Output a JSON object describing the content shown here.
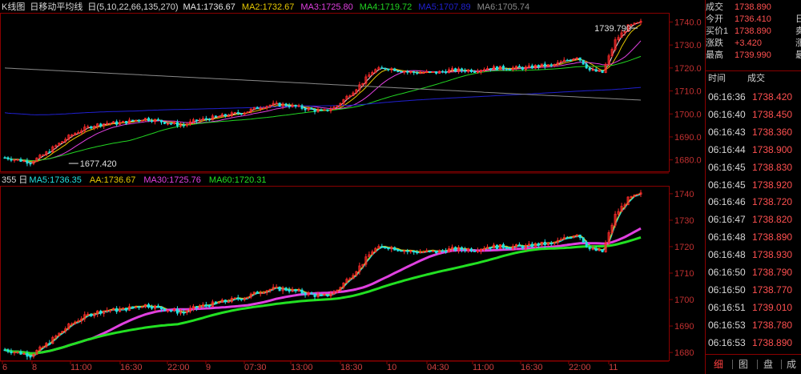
{
  "top_panel": {
    "label_kline": "K线图",
    "label_ma": "日移动平均线",
    "label_params": "日(5,10,22,66,135,270)",
    "ma_values": [
      {
        "label": "MA1:1736.67",
        "color": "#e6e6e6"
      },
      {
        "label": "MA2:1732.67",
        "color": "#e6c800"
      },
      {
        "label": "MA3:1725.80",
        "color": "#e040e0"
      },
      {
        "label": "MA4:1719.72",
        "color": "#22d422"
      },
      {
        "label": "MA5:1707.89",
        "color": "#2020d0"
      },
      {
        "label": "MA6:1705.74",
        "color": "#8a8a8a"
      }
    ],
    "annotation_high": "1739.790",
    "annotation_low": "1677.420"
  },
  "bottom_panel": {
    "label_period": "355 日",
    "ma_values": [
      {
        "label": "MA5:1736.35",
        "color": "#22e0e0"
      },
      {
        "label": "AA:1736.67",
        "color": "#e6c800"
      },
      {
        "label": "MA30:1725.76",
        "color": "#e040e0"
      },
      {
        "label": "MA60:1720.31",
        "color": "#22e022"
      }
    ]
  },
  "time_axis": [
    "6",
    "8",
    "11:00",
    "16:30",
    "22:00",
    "9",
    "07:30",
    "13:00",
    "18:30",
    "10",
    "04:30",
    "11:00",
    "16:30",
    "22:00",
    "11"
  ],
  "chart_data": [
    {
      "type": "candlestick",
      "title": "",
      "ylim": [
        1675,
        1744
      ],
      "yticks": [
        1680.0,
        1690.0,
        1700.0,
        1710.0,
        1720.0,
        1730.0,
        1740.0
      ],
      "close_path": [
        1681,
        1680,
        1679,
        1682,
        1686,
        1690,
        1693,
        1695,
        1696,
        1696,
        1697,
        1698,
        1697,
        1696,
        1695,
        1697,
        1698,
        1699,
        1700,
        1701,
        1703,
        1704,
        1704,
        1703,
        1702,
        1701,
        1703,
        1708,
        1713,
        1719,
        1720,
        1719,
        1718,
        1718,
        1718,
        1719,
        1719,
        1719,
        1720,
        1720,
        1720,
        1720,
        1721,
        1721,
        1723,
        1725,
        1719,
        1718,
        1732,
        1738,
        1739.79
      ],
      "high_label": "1739.790",
      "low_label": "1677.420",
      "series": [
        {
          "name": "MA1",
          "color": "#e6e6e6"
        },
        {
          "name": "MA2",
          "color": "#e6c800"
        },
        {
          "name": "MA3",
          "color": "#e040e0"
        },
        {
          "name": "MA4",
          "color": "#22d422"
        },
        {
          "name": "MA5",
          "color": "#2020d0"
        },
        {
          "name": "MA6",
          "color": "#8a8a8a"
        }
      ]
    },
    {
      "type": "candlestick",
      "title": "",
      "ylim": [
        1677,
        1743
      ],
      "yticks": [
        1680,
        1690,
        1700,
        1710,
        1720,
        1730,
        1740
      ],
      "series": [
        {
          "name": "MA5",
          "color": "#22e0e0"
        },
        {
          "name": "AA",
          "color": "#e6c800"
        },
        {
          "name": "MA30",
          "color": "#e040e0"
        },
        {
          "name": "MA60",
          "color": "#22e022"
        }
      ]
    }
  ],
  "quote": {
    "rows": [
      {
        "label": "成交",
        "value": "1738.890",
        "color": "#ff5050",
        "extra": ""
      },
      {
        "label": "今开",
        "value": "1736.410",
        "color": "#ff5050",
        "extra": "日"
      },
      {
        "label": "买价1",
        "value": "1738.890",
        "color": "#ff5050",
        "extra": "卖"
      },
      {
        "label": "涨跌",
        "value": "+3.420",
        "color": "#ff5050",
        "extra": "涨"
      },
      {
        "label": "最高",
        "value": "1739.990",
        "color": "#ff5050",
        "extra": "最"
      }
    ]
  },
  "trades": {
    "header_time": "时间",
    "header_price": "成交",
    "rows": [
      {
        "time": "06:16:36",
        "price": "1738.420"
      },
      {
        "time": "06:16:40",
        "price": "1738.450"
      },
      {
        "time": "06:16:43",
        "price": "1738.360"
      },
      {
        "time": "06:16:44",
        "price": "1738.900"
      },
      {
        "time": "06:16:45",
        "price": "1738.830"
      },
      {
        "time": "06:16:45",
        "price": "1738.920"
      },
      {
        "time": "06:16:46",
        "price": "1738.720"
      },
      {
        "time": "06:16:47",
        "price": "1738.820"
      },
      {
        "time": "06:16:48",
        "price": "1738.890"
      },
      {
        "time": "06:16:48",
        "price": "1738.930"
      },
      {
        "time": "06:16:50",
        "price": "1738.790"
      },
      {
        "time": "06:16:50",
        "price": "1738.770"
      },
      {
        "time": "06:16:51",
        "price": "1739.010"
      },
      {
        "time": "06:16:53",
        "price": "1738.780"
      },
      {
        "time": "06:16:53",
        "price": "1738.890"
      }
    ]
  },
  "tabs": [
    "细",
    "图",
    "盘",
    "成"
  ]
}
